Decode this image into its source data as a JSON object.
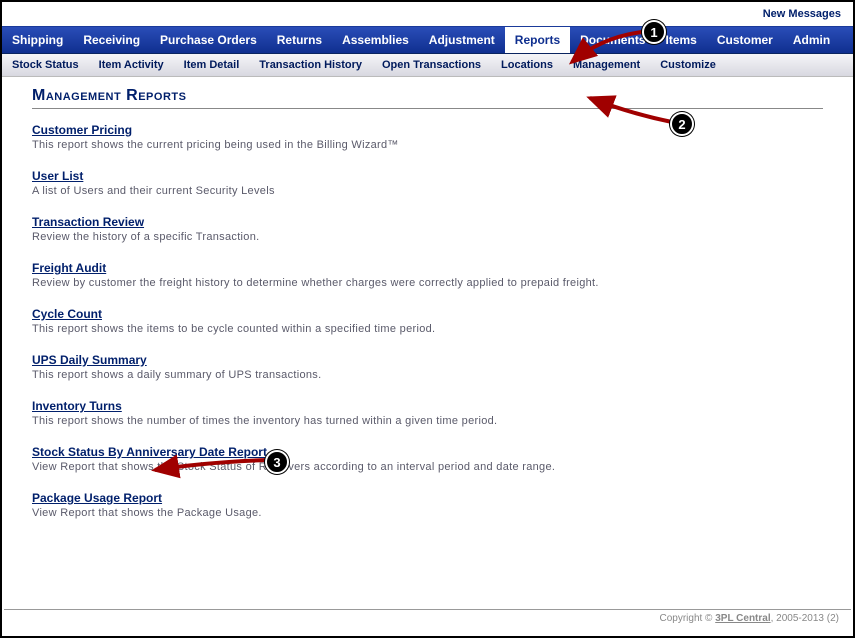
{
  "topBar": {
    "newMessages": "New Messages"
  },
  "mainNav": {
    "items": [
      "Shipping",
      "Receiving",
      "Purchase Orders",
      "Returns",
      "Assemblies",
      "Adjustment",
      "Reports",
      "Documents",
      "Items",
      "Customer",
      "Admin"
    ],
    "activeIndex": 6
  },
  "subNav": {
    "items": [
      "Stock Status",
      "Item Activity",
      "Item Detail",
      "Transaction History",
      "Open Transactions",
      "Locations",
      "Management",
      "Customize"
    ]
  },
  "pageTitle": "Management Reports",
  "reports": [
    {
      "title": "Customer Pricing",
      "desc": "This report shows the current pricing being used in the Billing Wizard™"
    },
    {
      "title": "User List",
      "desc": "A list of Users and their current Security Levels"
    },
    {
      "title": "Transaction Review",
      "desc": "Review the history of a specific Transaction."
    },
    {
      "title": "Freight Audit",
      "desc": "Review by customer the freight history to determine whether charges were correctly applied to prepaid freight."
    },
    {
      "title": "Cycle Count",
      "desc": "This report shows the items to be cycle counted within a specified time period."
    },
    {
      "title": "UPS Daily Summary",
      "desc": "This report shows a daily summary of UPS transactions."
    },
    {
      "title": "Inventory Turns",
      "desc": "This report shows the number of times the inventory has turned within a given time period."
    },
    {
      "title": "Stock Status By Anniversary Date Report",
      "desc": "View Report that shows the Stock Status of Receivers according to an interval period and date range."
    },
    {
      "title": "Package Usage Report",
      "desc": "View Report that shows the Package Usage."
    }
  ],
  "footer": {
    "prefix": "Copyright © ",
    "link": "3PL Central",
    "suffix": ", 2005-2013 (2)"
  },
  "annotations": {
    "b1": "1",
    "b2": "2",
    "b3": "3"
  }
}
